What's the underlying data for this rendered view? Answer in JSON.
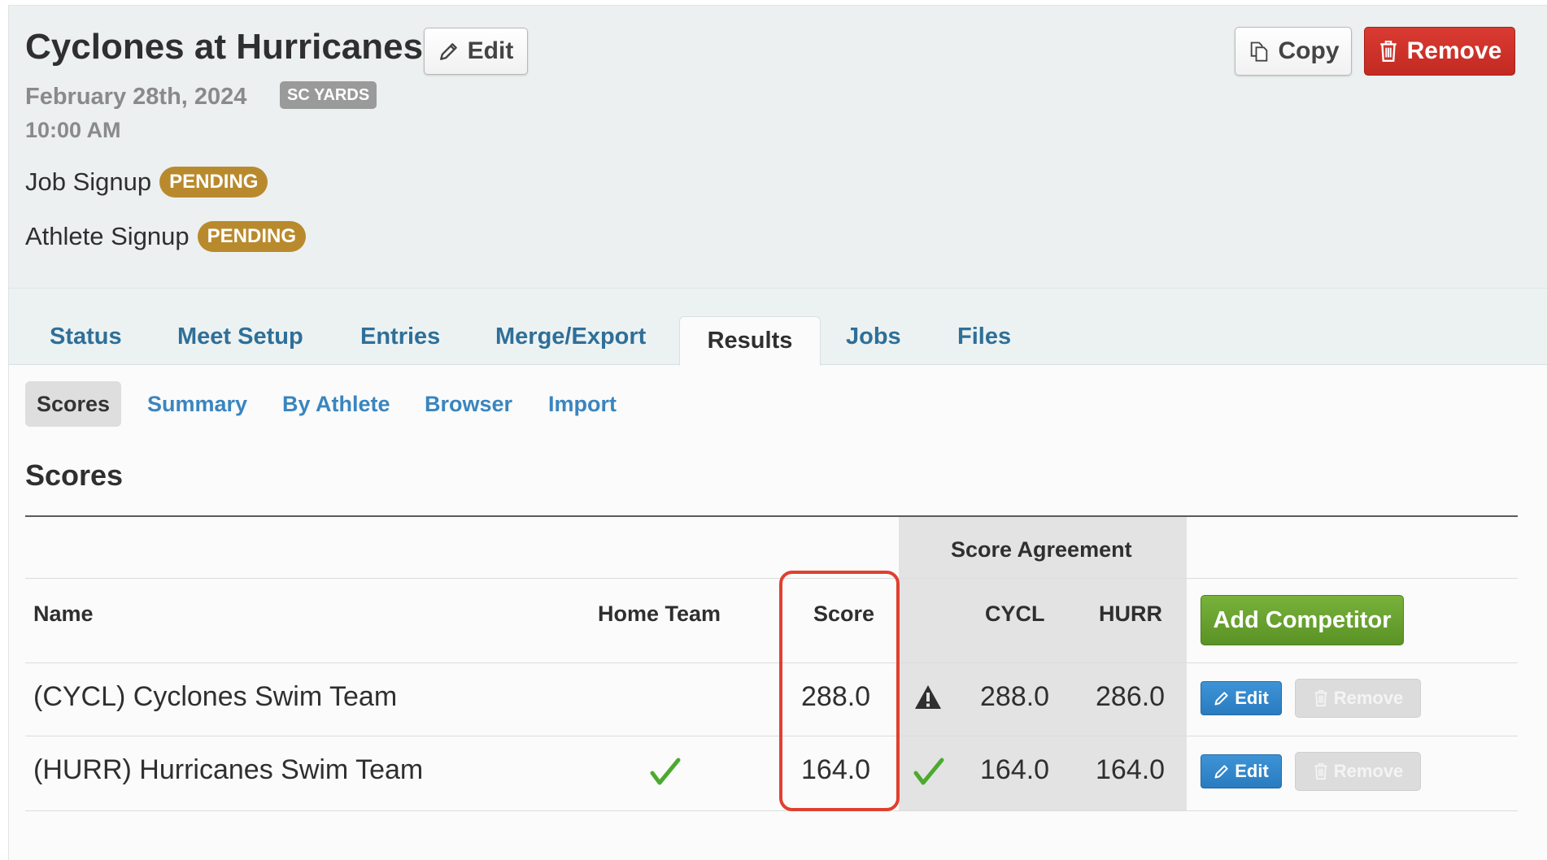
{
  "header": {
    "title": "Cyclones at Hurricanes",
    "edit_label": "Edit",
    "copy_label": "Copy",
    "remove_label": "Remove",
    "date": "February 28th, 2024",
    "course_badge": "SC YARDS",
    "time": "10:00 AM",
    "job_signup_label": "Job Signup",
    "job_signup_status": "PENDING",
    "athlete_signup_label": "Athlete Signup",
    "athlete_signup_status": "PENDING"
  },
  "tabs": [
    {
      "label": "Status"
    },
    {
      "label": "Meet Setup"
    },
    {
      "label": "Entries"
    },
    {
      "label": "Merge/Export"
    },
    {
      "label": "Results",
      "active": true
    },
    {
      "label": "Jobs"
    },
    {
      "label": "Files"
    }
  ],
  "subtabs": [
    {
      "label": "Scores",
      "active": true
    },
    {
      "label": "Summary"
    },
    {
      "label": "By Athlete"
    },
    {
      "label": "Browser"
    },
    {
      "label": "Import"
    }
  ],
  "section_title": "Scores",
  "table": {
    "group_header": "Score Agreement",
    "columns": {
      "name": "Name",
      "home_team": "Home Team",
      "score": "Score",
      "cycl": "CYCL",
      "hurr": "HURR"
    },
    "add_competitor_label": "Add Competitor",
    "rows": [
      {
        "name": "(CYCL) Cyclones Swim Team",
        "home": false,
        "score": "288.0",
        "agreement": "warning",
        "cycl": "288.0",
        "hurr": "286.0",
        "edit_label": "Edit",
        "remove_label": "Remove"
      },
      {
        "name": "(HURR) Hurricanes Swim Team",
        "home": true,
        "score": "164.0",
        "agreement": "agree",
        "cycl": "164.0",
        "hurr": "164.0",
        "edit_label": "Edit",
        "remove_label": "Remove"
      }
    ]
  },
  "colors": {
    "link": "#2f6f98",
    "pending": "#b98a2d",
    "remove": "#c9302c",
    "success": "#5aa02c",
    "primary": "#2a7bc0",
    "highlight": "#e04030"
  }
}
